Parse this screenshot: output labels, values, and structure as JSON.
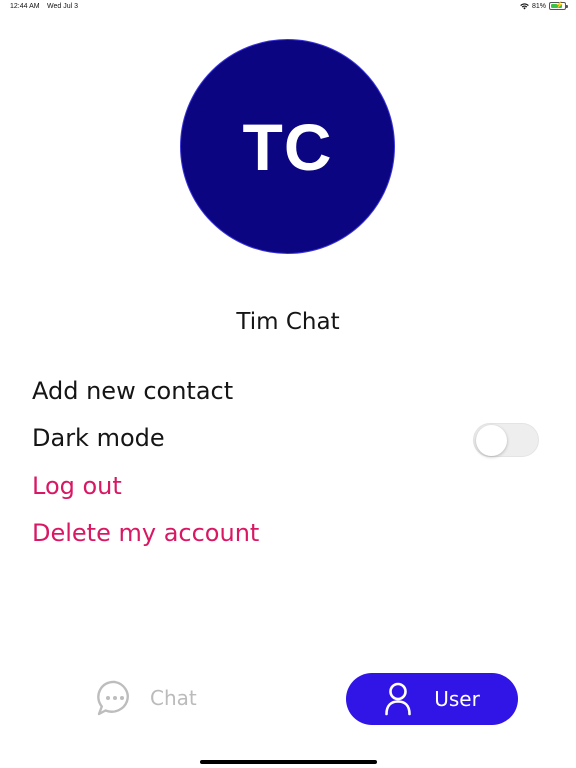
{
  "status_bar": {
    "time": "12:44 AM",
    "date": "Wed Jul 3",
    "battery_percent": "81%",
    "battery_level": 0.81,
    "wifi_icon": "wifi-icon",
    "battery_icon": "battery-charging-icon"
  },
  "profile": {
    "initials": "TC",
    "name": "Tim Chat",
    "avatar_color": "#0c0582"
  },
  "menu": {
    "add_contact": "Add new contact",
    "dark_mode": "Dark mode",
    "dark_mode_enabled": false,
    "log_out": "Log out",
    "delete_account": "Delete my account",
    "danger_color": "#d91864"
  },
  "tab_bar": {
    "chat_label": "Chat",
    "chat_icon": "chat-bubble-icon",
    "user_label": "User",
    "user_icon": "user-icon",
    "active_tab": "User",
    "accent_color": "#3115e6"
  }
}
